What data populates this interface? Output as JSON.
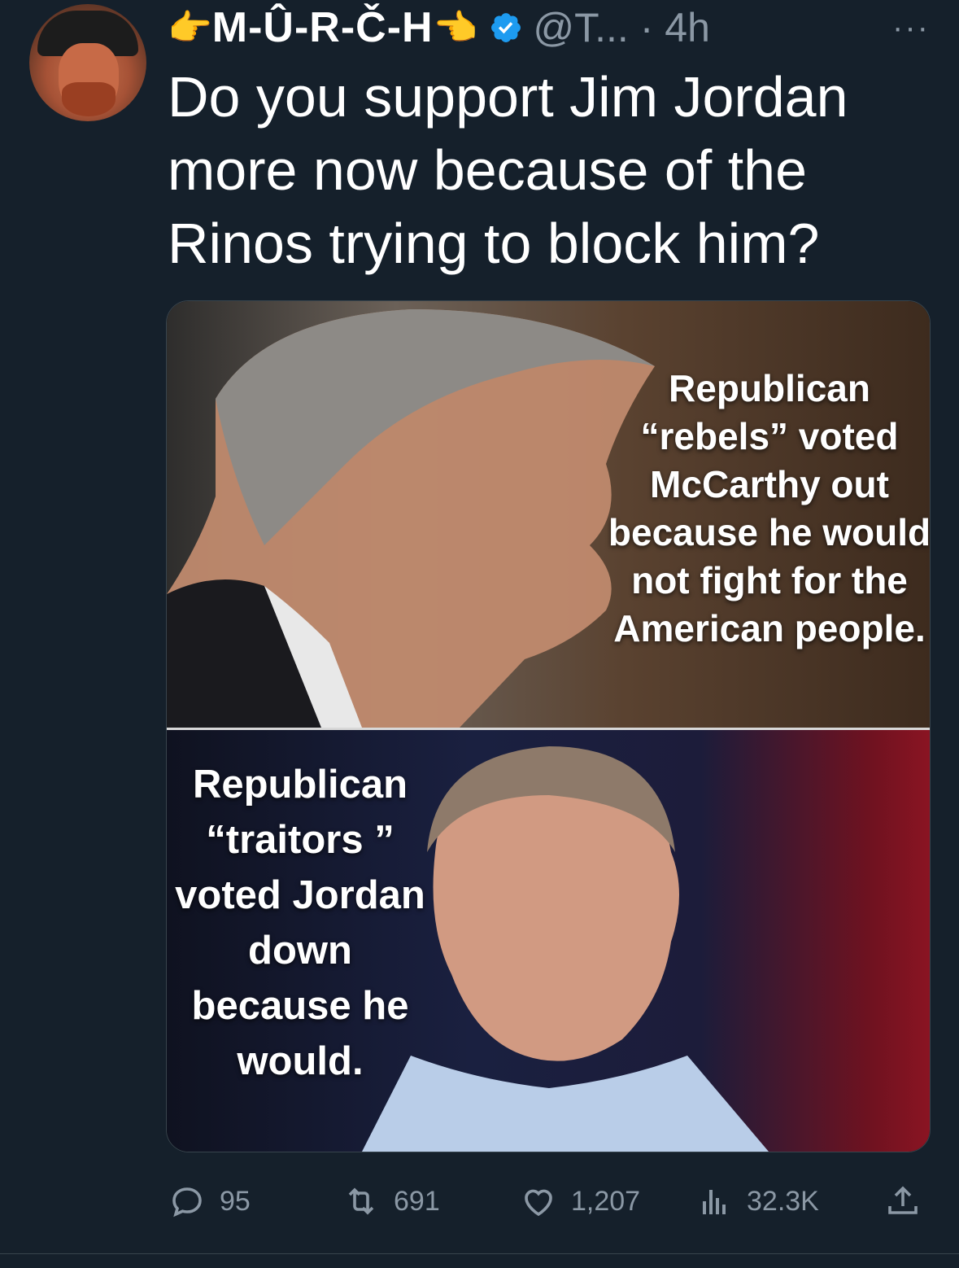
{
  "author": {
    "display_name": "M-Û-R-Č-H",
    "emoji_left": "👉",
    "emoji_right": "👈",
    "handle_time": "@T... · 4h",
    "more": "···"
  },
  "tweet": {
    "text": "Do you support Jim Jordan more now because of the Rinos trying to block him?"
  },
  "media": {
    "top_caption": "Republican “rebels” voted McCarthy out because he would not fight for the American people.",
    "bottom_caption": "Republican “traitors ” voted Jordan down because he would."
  },
  "actions": {
    "replies": "95",
    "retweets": "691",
    "likes": "1,207",
    "views": "32.3K"
  },
  "colors": {
    "background": "#15202b",
    "secondary_text": "#8b98a5",
    "verified_blue": "#1d9bf0"
  }
}
